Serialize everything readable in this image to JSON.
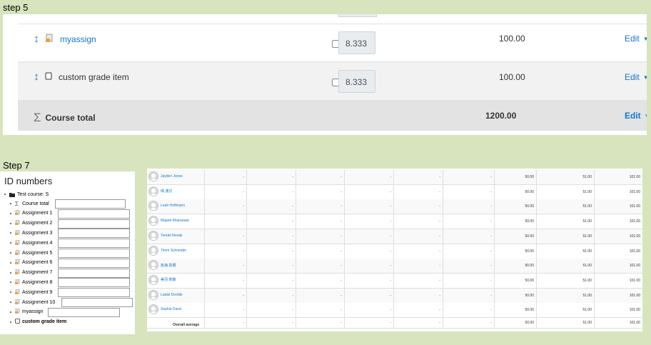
{
  "step5": {
    "label": "step 5",
    "rows": [
      {
        "name": "myassign",
        "icon": "assignment-icon",
        "weight": "8.333",
        "max": "100.00",
        "edit": "Edit",
        "link": true
      },
      {
        "name": "custom grade item",
        "icon": "grade-item-icon",
        "weight": "8.333",
        "max": "100.00",
        "edit": "Edit",
        "link": false
      }
    ],
    "total": {
      "name": "Course total",
      "max": "1200.00",
      "edit": "Edit"
    }
  },
  "step7": {
    "label": "Step 7",
    "title": "ID numbers",
    "course": "Test course: S",
    "items": [
      {
        "label": "Course total",
        "icon": "sigma-icon"
      },
      {
        "label": "Assignment 1",
        "icon": "assignment-icon"
      },
      {
        "label": "Assignment 2",
        "icon": "assignment-icon"
      },
      {
        "label": "Assignment 3",
        "icon": "assignment-icon"
      },
      {
        "label": "Assignment 4",
        "icon": "assignment-icon"
      },
      {
        "label": "Assignment 5",
        "icon": "assignment-icon"
      },
      {
        "label": "Assignment 6",
        "icon": "assignment-icon"
      },
      {
        "label": "Assignment 7",
        "icon": "assignment-icon"
      },
      {
        "label": "Assignment 8",
        "icon": "assignment-icon"
      },
      {
        "label": "Assignment 9",
        "icon": "assignment-icon"
      },
      {
        "label": "Assignment 10",
        "icon": "assignment-icon"
      },
      {
        "label": "myassign",
        "icon": "assignment-icon"
      },
      {
        "label": "custom grade item",
        "icon": "grade-item-icon"
      }
    ]
  },
  "report": {
    "students": [
      {
        "name": "Jayden Jones",
        "vals": [
          "-",
          "-",
          "-",
          "-",
          "-",
          "-",
          "50.00",
          "51.00",
          "101.00"
        ]
      },
      {
        "name": "晴 渡辺",
        "vals": [
          "-",
          "-",
          "-",
          "-",
          "-",
          "-",
          "50.00",
          "51.00",
          "101.00"
        ]
      },
      {
        "name": "Leah Hoffmann",
        "vals": [
          "-",
          "-",
          "-",
          "-",
          "-",
          "-",
          "50.00",
          "51.00",
          "101.00"
        ]
      },
      {
        "name": "Мария Морозова",
        "vals": [
          "-",
          "-",
          "-",
          "-",
          "-",
          "-",
          "50.00",
          "51.00",
          "101.00"
        ]
      },
      {
        "name": "Tomáš Novák",
        "vals": [
          "-",
          "-",
          "-",
          "-",
          "-",
          "-",
          "50.00",
          "51.00",
          "101.00"
        ]
      },
      {
        "name": "Timm Schneider",
        "vals": [
          "-",
          "-",
          "-",
          "-",
          "-",
          "-",
          "50.00",
          "51.00",
          "101.00"
        ]
      },
      {
        "name": "拓海 高橋",
        "vals": [
          "-",
          "-",
          "-",
          "-",
          "-",
          "-",
          "50.00",
          "51.00",
          "101.00"
        ]
      },
      {
        "name": "美羽 斎藤",
        "vals": [
          "-",
          "-",
          "-",
          "-",
          "-",
          "-",
          "50.00",
          "51.00",
          "101.00"
        ]
      },
      {
        "name": "Lukáš Dvořák",
        "vals": [
          "-",
          "-",
          "-",
          "-",
          "-",
          "-",
          "50.00",
          "51.00",
          "101.00"
        ]
      },
      {
        "name": "Sophia Davis",
        "vals": [
          "-",
          "-",
          "-",
          "-",
          "-",
          "-",
          "50.00",
          "51.00",
          "101.00"
        ]
      }
    ],
    "average": {
      "label": "Overall average",
      "vals": [
        "-",
        "-",
        "-",
        "-",
        "-",
        "-",
        "50.00",
        "51.00",
        "101.00"
      ]
    }
  }
}
